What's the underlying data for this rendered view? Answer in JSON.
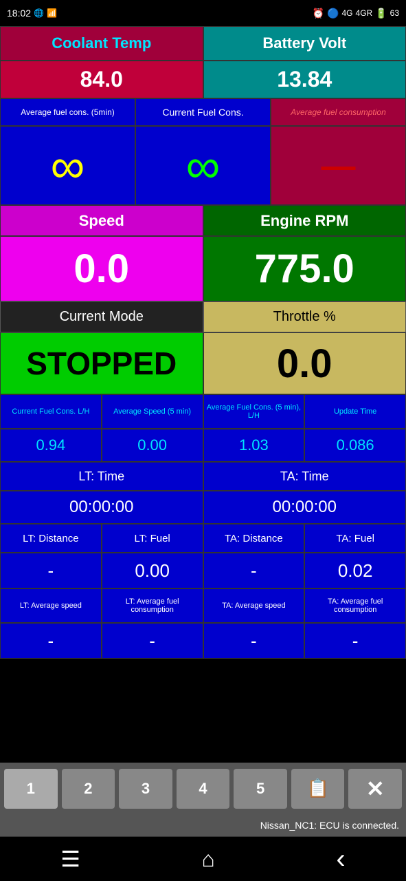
{
  "status_bar": {
    "time": "18:02",
    "right_icons": "🔵📶4G 4GR 🔋63"
  },
  "row1": {
    "coolant_label": "Coolant Temp",
    "battery_label": "Battery Volt"
  },
  "row2": {
    "coolant_value": "84.0",
    "battery_value": "13.84"
  },
  "row3": {
    "avg_fuel_label": "Average fuel cons. (5min)",
    "current_fuel_label": "Current Fuel Cons.",
    "avg_fuel_consumption_label": "Average fuel consumption"
  },
  "row4": {
    "infinity1": "∞",
    "infinity2": "∞",
    "dash": "—"
  },
  "row5": {
    "speed_label": "Speed",
    "rpm_label": "Engine RPM"
  },
  "row6": {
    "speed_value": "0.0",
    "rpm_value": "775.0"
  },
  "row7": {
    "mode_label": "Current Mode",
    "throttle_label": "Throttle %"
  },
  "row8": {
    "mode_value": "STOPPED",
    "throttle_value": "0.0"
  },
  "row9": {
    "stat1_label": "Current Fuel Cons. L/H",
    "stat2_label": "Average Speed (5 min)",
    "stat3_label": "Average Fuel Cons. (5 min), L/H",
    "stat4_label": "Update Time"
  },
  "row10": {
    "stat1_value": "0.94",
    "stat2_value": "0.00",
    "stat3_value": "1.03",
    "stat4_value": "0.086"
  },
  "row11": {
    "lt_time_label": "LT: Time",
    "ta_time_label": "TA: Time"
  },
  "row12": {
    "lt_time_value": "00:00:00",
    "ta_time_value": "00:00:00"
  },
  "row13": {
    "lt_dist_label": "LT: Distance",
    "lt_fuel_label": "LT: Fuel",
    "ta_dist_label": "TA: Distance",
    "ta_fuel_label": "TA: Fuel"
  },
  "row14": {
    "lt_dist_value": "-",
    "lt_fuel_value": "0.00",
    "ta_dist_value": "-",
    "ta_fuel_value": "0.02"
  },
  "row15": {
    "lt_avg_speed_label": "LT: Average speed",
    "lt_avg_fuel_label": "LT: Average fuel consumption",
    "ta_avg_speed_label": "TA: Average speed",
    "ta_avg_fuel_label": "TA: Average fuel consumption"
  },
  "row16": {
    "lt_avg_speed_value": "-",
    "lt_avg_fuel_value": "-",
    "ta_avg_speed_value": "-",
    "ta_avg_fuel_value": "-"
  },
  "tabs": {
    "tab1": "1",
    "tab2": "2",
    "tab3": "3",
    "tab4": "4",
    "tab5": "5"
  },
  "status_message": "Nissan_NC1: ECU is connected.",
  "nav": {
    "menu": "☰",
    "home": "⌂",
    "back": "‹"
  }
}
